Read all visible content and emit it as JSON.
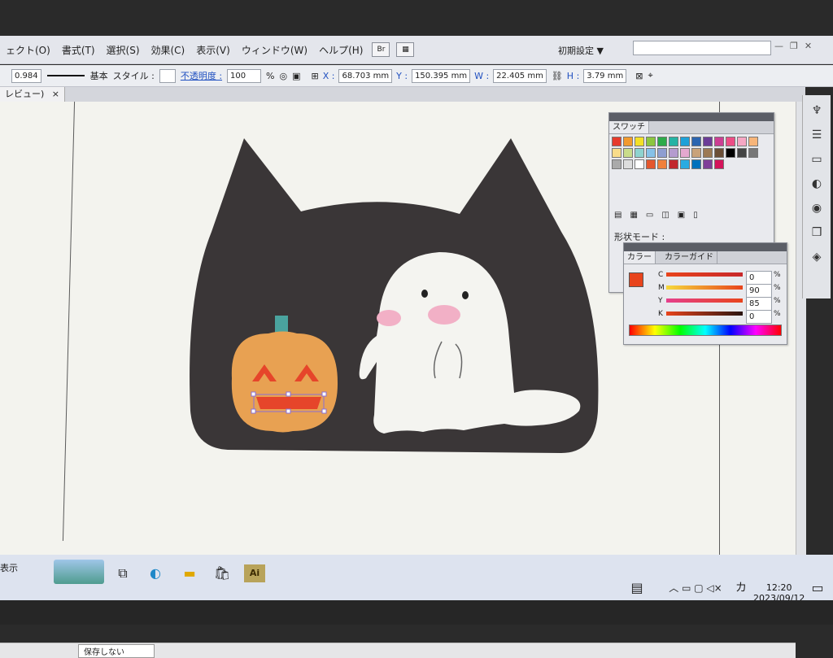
{
  "menubar": {
    "items": [
      "ェクト(O)",
      "書式(T)",
      "選択(S)",
      "効果(C)",
      "表示(V)",
      "ウィンドウ(W)",
      "ヘルプ(H)"
    ],
    "bridge_label": "Br",
    "workspace": "初期設定 ▼"
  },
  "controlbar": {
    "stroke_width": "0.984",
    "stroke_style": "基本",
    "style_label": "スタイル :",
    "opacity_label": "不透明度 :",
    "opacity_value": "100",
    "opacity_unit": "%",
    "x_label": "X :",
    "x_value": "68.703 mm",
    "y_label": "Y :",
    "y_value": "150.395 mm",
    "w_label": "W :",
    "w_value": "22.405 mm",
    "h_label": "H :",
    "h_value": "3.79 mm"
  },
  "doc": {
    "tab_label": "レビュー)",
    "close": "×"
  },
  "status": {
    "label": "保存しない",
    "left_text": "表示"
  },
  "swatches_panel": {
    "title": "スワッチ",
    "colors": [
      "#e63a2c",
      "#f29a2e",
      "#f3e027",
      "#8cc63f",
      "#2dab4a",
      "#25b3a4",
      "#1da1d8",
      "#2b65b0",
      "#6b3d97",
      "#cc3f93",
      "#ed4d86",
      "#f6a7c4",
      "#f7b57a",
      "#f8dc8a",
      "#c9dc8a",
      "#8ed3cf",
      "#86c1e8",
      "#8e9ed1",
      "#b49bcf",
      "#e4a8cf",
      "#c9a27a",
      "#9c7a55",
      "#6b4f37",
      "#000000",
      "#444444",
      "#777777",
      "#aaaaaa",
      "#dddddd",
      "#ffffff",
      "#e4572e",
      "#f0803c",
      "#c1272d",
      "#29abe2",
      "#0071bc",
      "#7f3f98",
      "#d4145a"
    ],
    "shape_mode": "形状モード :"
  },
  "color_panel": {
    "tab_color": "カラー",
    "tab_guide": "カラーガイド",
    "fill_color": "#e8441c",
    "c_label": "C",
    "c_value": "0",
    "m_label": "M",
    "m_value": "90",
    "y_label": "Y",
    "y_value": "85",
    "k_label": "K",
    "k_value": "0",
    "unit": "%"
  },
  "taskbar": {
    "time": "12:20",
    "date": "2023/09/12",
    "ime": "カ",
    "ai_label": "Ai"
  }
}
